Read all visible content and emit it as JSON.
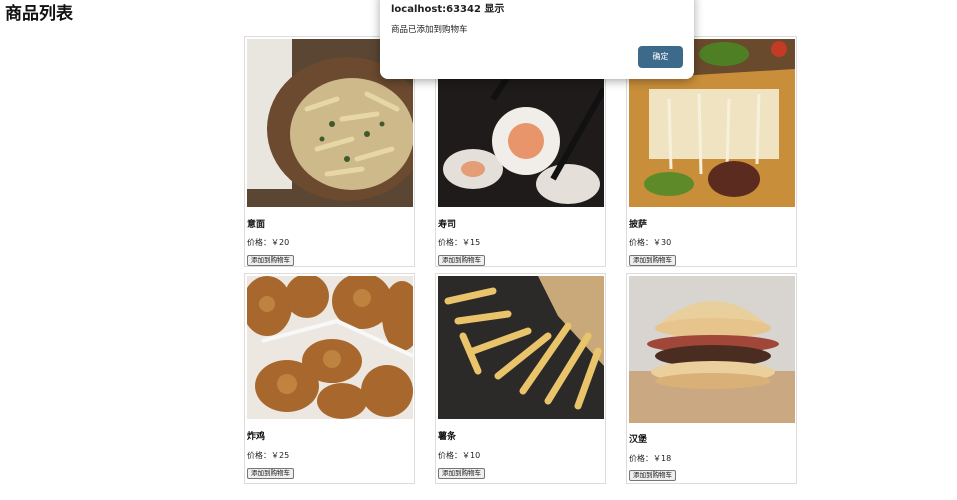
{
  "page": {
    "title": "商品列表"
  },
  "products": [
    {
      "name": "意面",
      "price": "价格：￥20",
      "button": "添加到购物车",
      "image": "pasta-photo"
    },
    {
      "name": "寿司",
      "price": "价格：￥15",
      "button": "添加到购物车",
      "image": "sushi-photo"
    },
    {
      "name": "披萨",
      "price": "价格：￥30",
      "button": "添加到购物车",
      "image": "pizza-photo"
    },
    {
      "name": "炸鸡",
      "price": "价格：￥25",
      "button": "添加到购物车",
      "image": "fried-chicken-photo"
    },
    {
      "name": "薯条",
      "price": "价格：￥10",
      "button": "添加到购物车",
      "image": "fries-photo"
    },
    {
      "name": "汉堡",
      "price": "价格：￥18",
      "button": "添加到购物车",
      "image": "burger-photo"
    }
  ],
  "dialog": {
    "title": "localhost:63342 显示",
    "message": "商品已添加到购物车",
    "ok_label": "确定",
    "ok_color": "#3c6a8a"
  }
}
